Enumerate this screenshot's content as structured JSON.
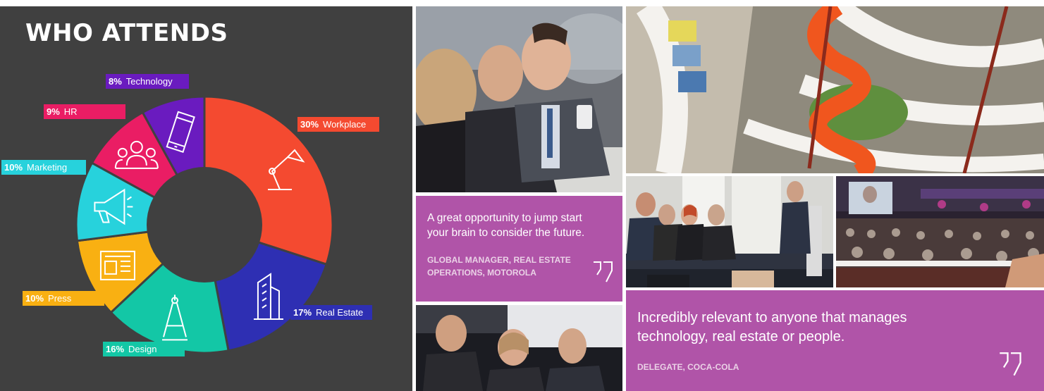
{
  "chart_title": "WHO ATTENDS",
  "chart_data": {
    "type": "pie",
    "categories": [
      "Workplace",
      "Real Estate",
      "Design",
      "Press",
      "Marketing",
      "HR",
      "Technology"
    ],
    "values": [
      30,
      17,
      16,
      10,
      10,
      9,
      8
    ],
    "labels": [
      "30%",
      "17%",
      "16%",
      "10%",
      "10%",
      "9%",
      "8%"
    ],
    "colors": [
      "#f44a30",
      "#2e2fb3",
      "#13c7a6",
      "#f9b012",
      "#27d2dc",
      "#ea1d64",
      "#6a1bbf"
    ],
    "icons": [
      "desk-lamp-icon",
      "building-icon",
      "compass-icon",
      "newspaper-icon",
      "megaphone-icon",
      "people-icon",
      "phone-icon"
    ],
    "title": "WHO ATTENDS"
  },
  "quotes": [
    {
      "text_line1": "A great opportunity to jump start",
      "text_line2": "your brain to consider the future.",
      "author_line1": "GLOBAL MANAGER, REAL ESTATE",
      "author_line2": "OPERATIONS, MOTOROLA"
    },
    {
      "text_line1": "Incredibly relevant to anyone that manages",
      "text_line2": "technology, real estate or people.",
      "author_line1": "DELEGATE, COCA-COLA"
    }
  ],
  "colors": {
    "panel_bg": "#404040",
    "quote_bg": "#b054a8"
  }
}
